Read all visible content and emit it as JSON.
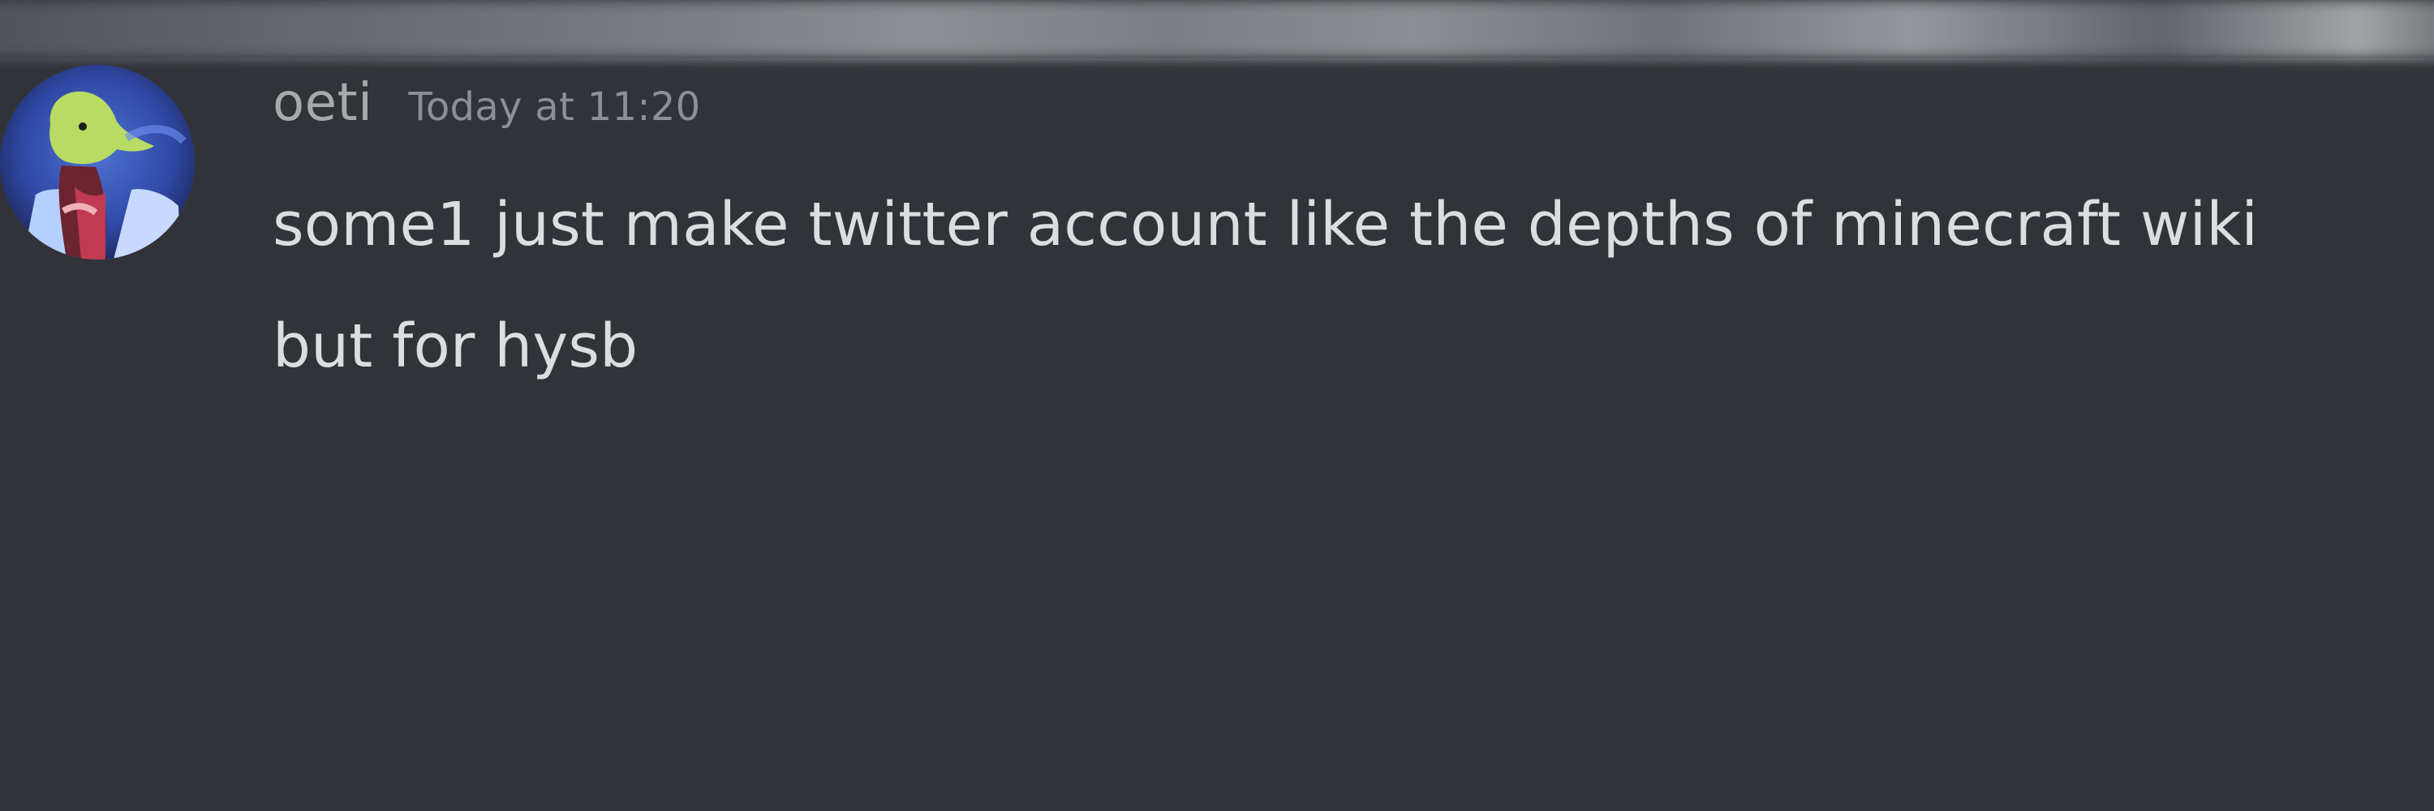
{
  "message": {
    "avatar": {
      "icon": "profile-avatar",
      "background_color": "#2f48a5",
      "accent_color": "#b7db63"
    },
    "username": "oeti",
    "timestamp": "Today at 11:20",
    "content_lines": [
      "some1 just make twitter account like the depths of minecraft wiki",
      "but for hysb"
    ]
  },
  "colors": {
    "background": "#313338",
    "username": "#a7a9ad",
    "timestamp": "#8c8f95",
    "message_text": "#dbdee1"
  }
}
